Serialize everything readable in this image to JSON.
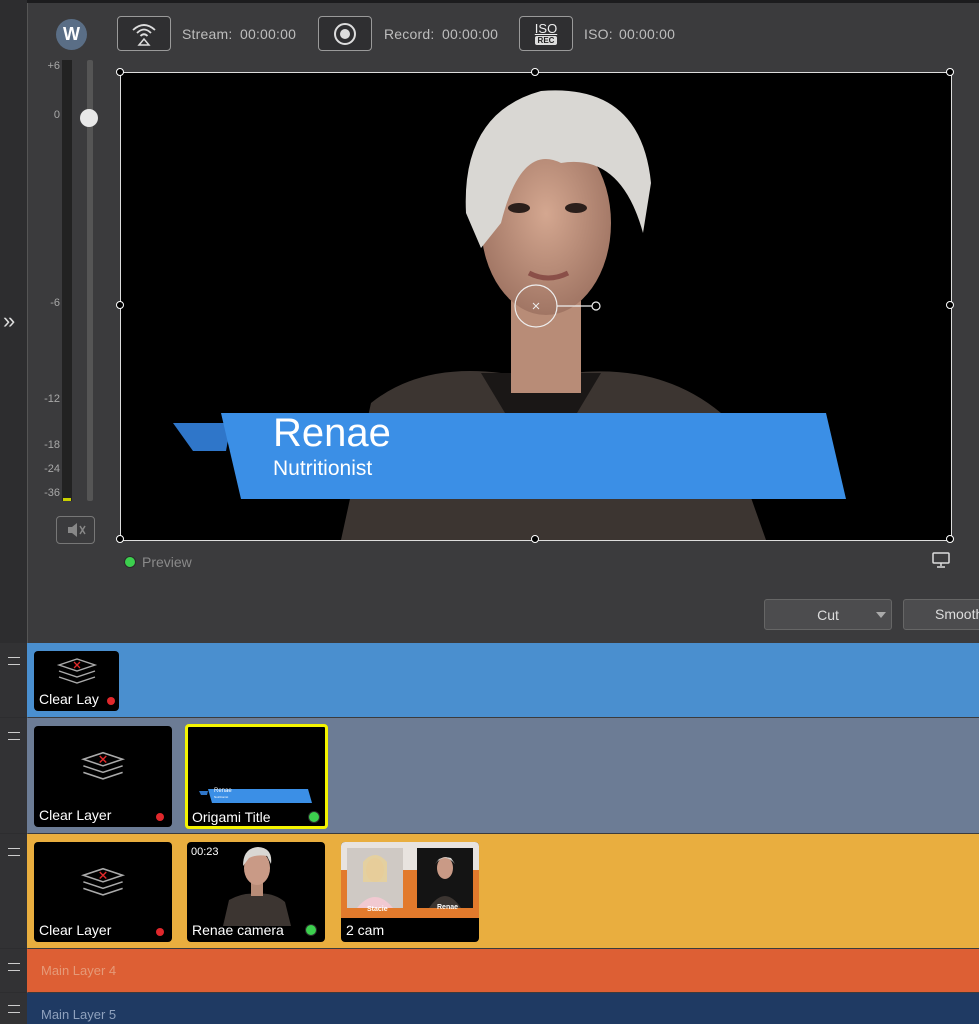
{
  "toolbar": {
    "stream_label": "Stream:",
    "stream_time": "00:00:00",
    "record_label": "Record:",
    "record_time": "00:00:00",
    "iso_label": "ISO:",
    "iso_time": "00:00:00",
    "iso_button_top": "ISO",
    "iso_button_bottom": "REC"
  },
  "audio_meter": {
    "scale": [
      "+6",
      "0",
      "-6",
      "-12",
      "-18",
      "-24",
      "-36"
    ]
  },
  "preview": {
    "status_label": "Preview",
    "lower_third": {
      "name": "Renae",
      "subtitle": "Nutritionist"
    }
  },
  "transition": {
    "type": "Cut",
    "smooth_label": "Smooth"
  },
  "layers": {
    "layer1": {
      "thumbs": [
        {
          "label": "Clear Lay"
        }
      ]
    },
    "layer2": {
      "thumbs": [
        {
          "label": "Clear Layer"
        },
        {
          "label": "Origami Title",
          "mini_name": "Renae",
          "mini_sub": "Nutritionist"
        }
      ]
    },
    "layer3": {
      "thumbs": [
        {
          "label": "Clear Layer"
        },
        {
          "label": "Renae camera",
          "time": "00:23"
        },
        {
          "label": "2 cam",
          "left_tag": "Stacie",
          "right_tag": "Renae"
        }
      ]
    },
    "layer4": {
      "name": "Main Layer 4"
    },
    "layer5": {
      "name": "Main Layer 5"
    }
  },
  "colors": {
    "layer1": "#4a8fcf",
    "layer2": "#6c7c95",
    "layer3": "#e9ae3f",
    "layer4": "#dd5f34",
    "layer5": "#1f3a63",
    "banner": "#3b8fe6",
    "selected_border": "#f4f400"
  }
}
